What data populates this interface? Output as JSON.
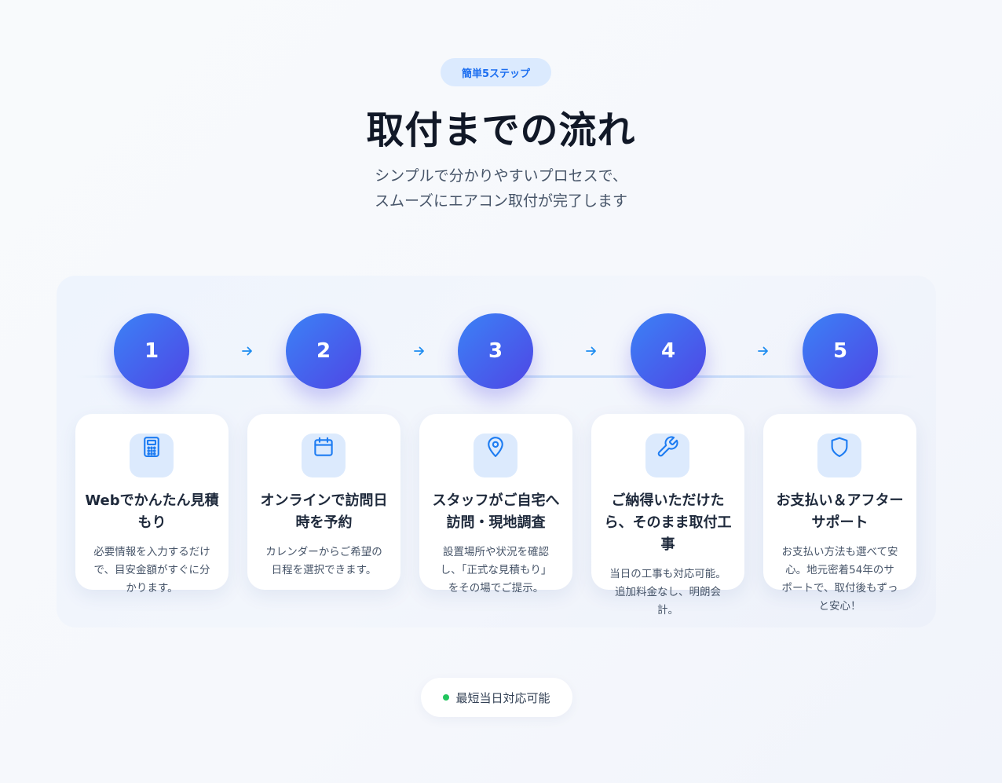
{
  "header": {
    "badge": "簡単5ステップ",
    "title": "取付までの流れ",
    "subtitle_line1": "シンプルで分かりやすいプロセスで、",
    "subtitle_line2": "スムーズにエアコン取付が完了します"
  },
  "steps": [
    {
      "number": "1",
      "icon": "calculator-icon",
      "title": "Webでかんたん見積もり",
      "description": "必要情報を入力するだけで、目安金額がすぐに分かります。"
    },
    {
      "number": "2",
      "icon": "calendar-icon",
      "title": "オンラインで訪問日時を予約",
      "description": "カレンダーからご希望の日程を選択できます。"
    },
    {
      "number": "3",
      "icon": "map-pin-icon",
      "title": "スタッフがご自宅へ訪問・現地調査",
      "description": "設置場所や状況を確認し、「正式な見積もり」をその場でご提示。"
    },
    {
      "number": "4",
      "icon": "wrench-icon",
      "title": "ご納得いただけたら、そのまま取付工事",
      "description": "当日の工事も対応可能。追加料金なし、明朗会計。"
    },
    {
      "number": "5",
      "icon": "shield-icon",
      "title": "お支払い＆アフターサポート",
      "description": "お支払い方法も選べて安心。地元密着54年のサポートで、取付後もずっと安心！"
    }
  ],
  "footer": {
    "availability": "最短当日対応可能"
  },
  "colors": {
    "accent": "#1d6ff0",
    "circle_gradient_start": "#3b82f6",
    "circle_gradient_end": "#4f46e5",
    "status": "#22c55e"
  }
}
